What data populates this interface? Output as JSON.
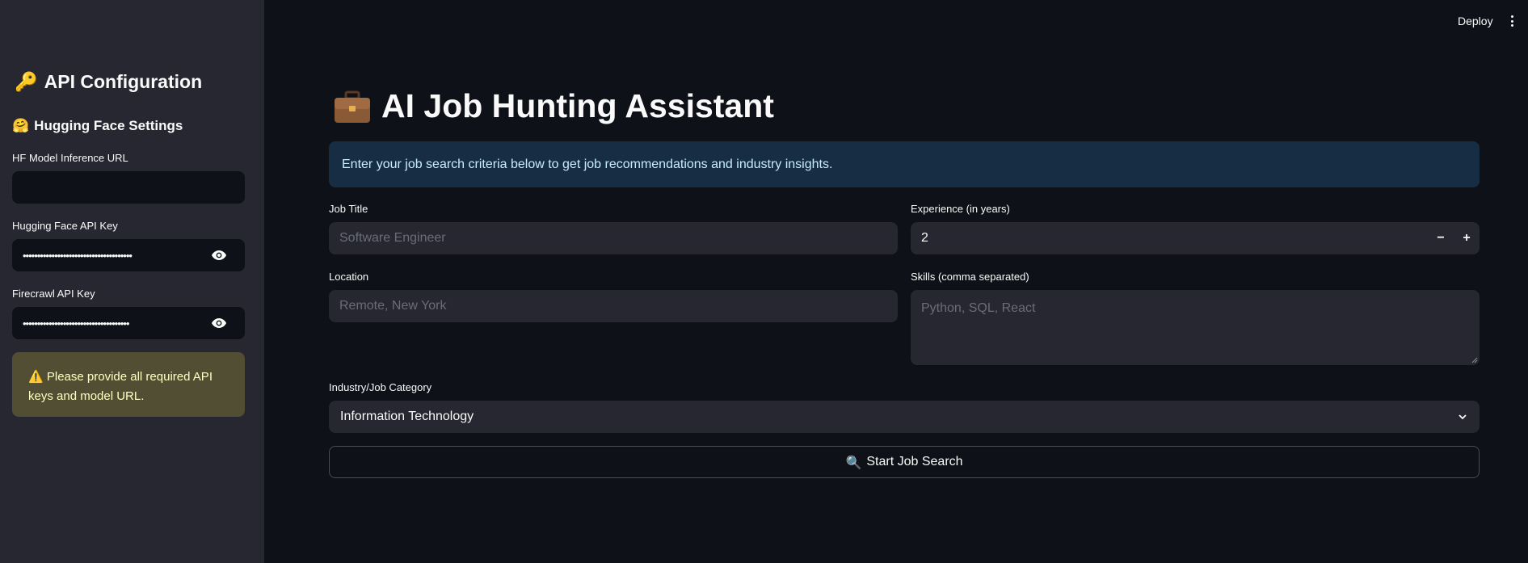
{
  "sidebar": {
    "title": "API Configuration",
    "title_emoji": "🔑",
    "subtitle": "Hugging Face Settings",
    "subtitle_emoji": "🤗",
    "fields": [
      {
        "label": "HF Model Inference URL",
        "value": ""
      },
      {
        "label": "Hugging Face API Key",
        "value": "••••••••••••••••••••••••••••••••••••••"
      },
      {
        "label": "Firecrawl API Key",
        "value": "•••••••••••••••••••••••••••••••••••••"
      }
    ],
    "warning_emoji": "⚠️",
    "warning_text": "Please provide all required API keys and model URL."
  },
  "topbar": {
    "deploy_label": "Deploy"
  },
  "main": {
    "title": "AI Job Hunting Assistant",
    "title_icon": "briefcase-icon",
    "info_text": "Enter your job search criteria below to get job recommendations and industry insights.",
    "job_title": {
      "label": "Job Title",
      "placeholder": "Software Engineer"
    },
    "experience": {
      "label": "Experience (in years)",
      "value": "2",
      "minus": "−",
      "plus": "+"
    },
    "location": {
      "label": "Location",
      "placeholder": "Remote, New York"
    },
    "skills": {
      "label": "Skills (comma separated)",
      "placeholder": "Python, SQL, React"
    },
    "industry": {
      "label": "Industry/Job Category",
      "value": "Information Technology"
    },
    "start_button": {
      "label": "Start Job Search",
      "emoji": "🔍"
    }
  },
  "colors": {
    "background": "#0e1117",
    "sidebar": "#262730",
    "info_bg": "#172d43",
    "warning_bg": "#524e33"
  }
}
